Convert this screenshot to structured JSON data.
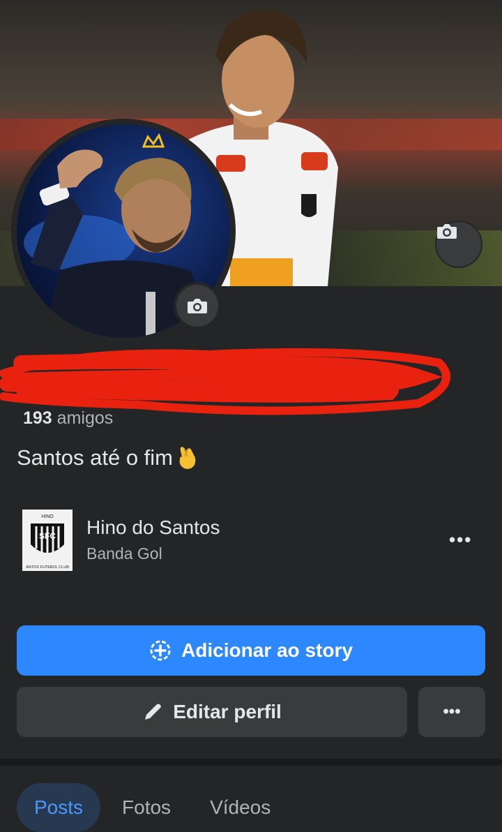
{
  "profile": {
    "friends_count": "193",
    "friends_label": "amigos",
    "bio": "Santos até o fim",
    "bio_emoji": "crossed-fingers-emoji"
  },
  "cover": {
    "camera_icon": "camera-icon"
  },
  "avatar": {
    "camera_icon": "camera-icon"
  },
  "music": {
    "title": "Hino do Santos",
    "artist": "Banda Gol",
    "thumb_text": "HINO",
    "thumb_caption": "ANTOS FUTEBOL CLUB",
    "more_label": "•••"
  },
  "actions": {
    "add_story_label": "Adicionar ao story",
    "edit_profile_label": "Editar perfil",
    "more_label": "•••"
  },
  "tabs": [
    {
      "label": "Posts",
      "active": true
    },
    {
      "label": "Fotos",
      "active": false
    },
    {
      "label": "Vídeos",
      "active": false
    }
  ],
  "colors": {
    "background": "#242526",
    "primary_button": "#2d88ff",
    "secondary_button": "#3a3b3c",
    "active_tab_bg": "#263951",
    "active_tab_text": "#4599ff",
    "scribble": "#e8220f"
  }
}
